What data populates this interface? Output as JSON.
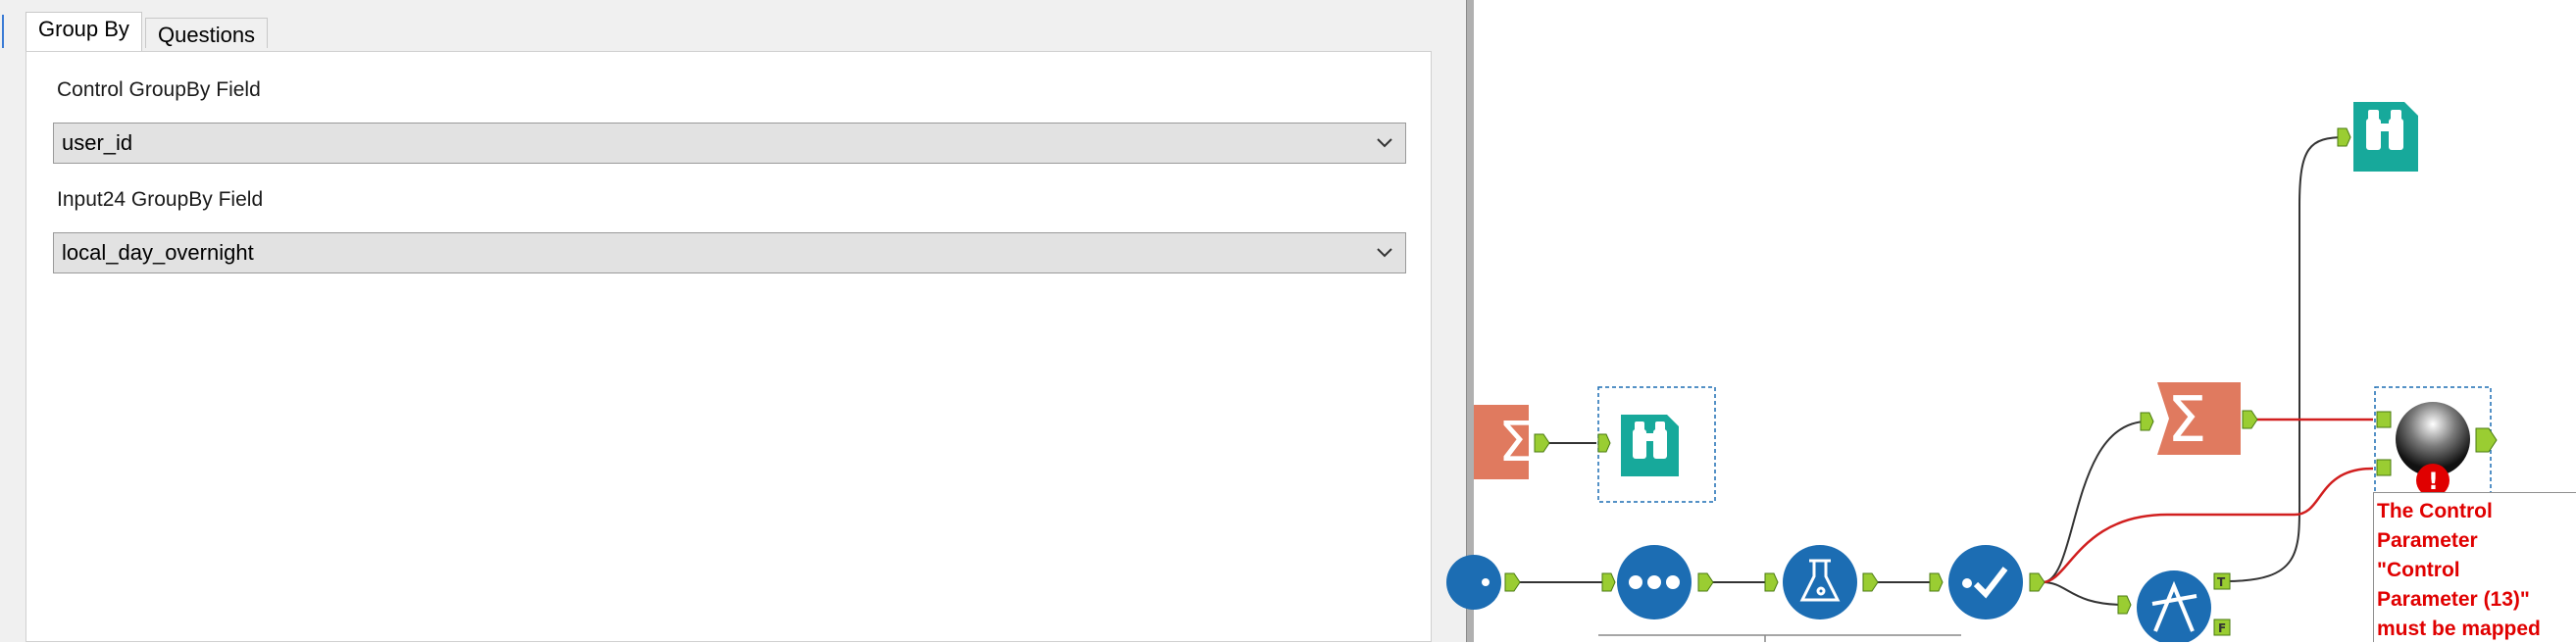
{
  "tabs": [
    {
      "label": "Group By",
      "active": true
    },
    {
      "label": "Questions",
      "active": false
    }
  ],
  "fields": [
    {
      "label": "Control GroupBy Field",
      "value": "user_id"
    },
    {
      "label": "Input24 GroupBy Field",
      "value": "local_day_overnight"
    }
  ],
  "canvas": {
    "error_message": [
      "The Control",
      "Parameter",
      "\"Control",
      "Parameter (13)\"",
      "must be mapped"
    ],
    "anchor_labels": {
      "true": "T",
      "false": "F"
    },
    "error_badge": "!",
    "colors": {
      "summarize": "#e07a5f",
      "browse": "#17a99b",
      "join_blue": "#1c6db3",
      "connection": "#333333",
      "error_connection": "#d11f1f",
      "anchor": "#9acd32",
      "error": "#e00000"
    },
    "icons": [
      "summarize-icon",
      "browse-icon",
      "select-records-icon",
      "sample-icon",
      "formula-icon",
      "filter-icon",
      "summarize-icon",
      "browse-icon",
      "ab-test-icon",
      "macro-sphere-icon"
    ]
  }
}
